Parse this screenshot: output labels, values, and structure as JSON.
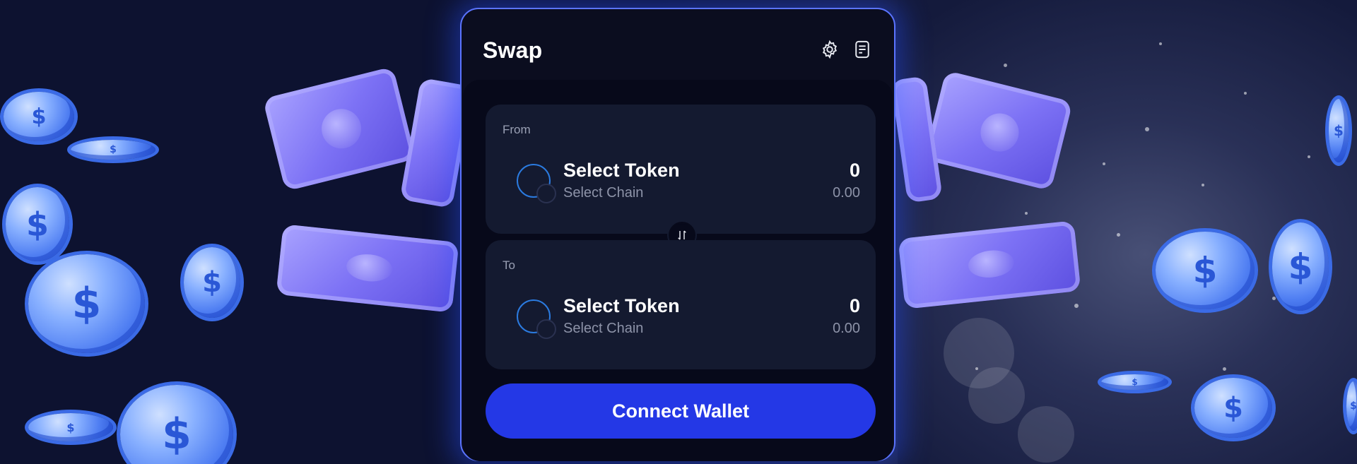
{
  "swap": {
    "title": "Swap",
    "icons": {
      "settings": "gear-icon",
      "history": "document-icon",
      "toggle": "swap-arrows-icon"
    },
    "from": {
      "label": "From",
      "token": "Select Token",
      "chain": "Select Chain",
      "amount": "0",
      "usd": "0.00"
    },
    "to": {
      "label": "To",
      "token": "Select Token",
      "chain": "Select Chain",
      "amount": "0",
      "usd": "0.00"
    },
    "connect_label": "Connect Wallet"
  },
  "colors": {
    "accent": "#2438e6",
    "card_border": "#5b74ff",
    "panel": "#141a30",
    "card_bg": "#0b0d1f",
    "coin": "#4f7ef2",
    "bill": "#7d72f5"
  },
  "background": {
    "coin_glyph": "$"
  }
}
